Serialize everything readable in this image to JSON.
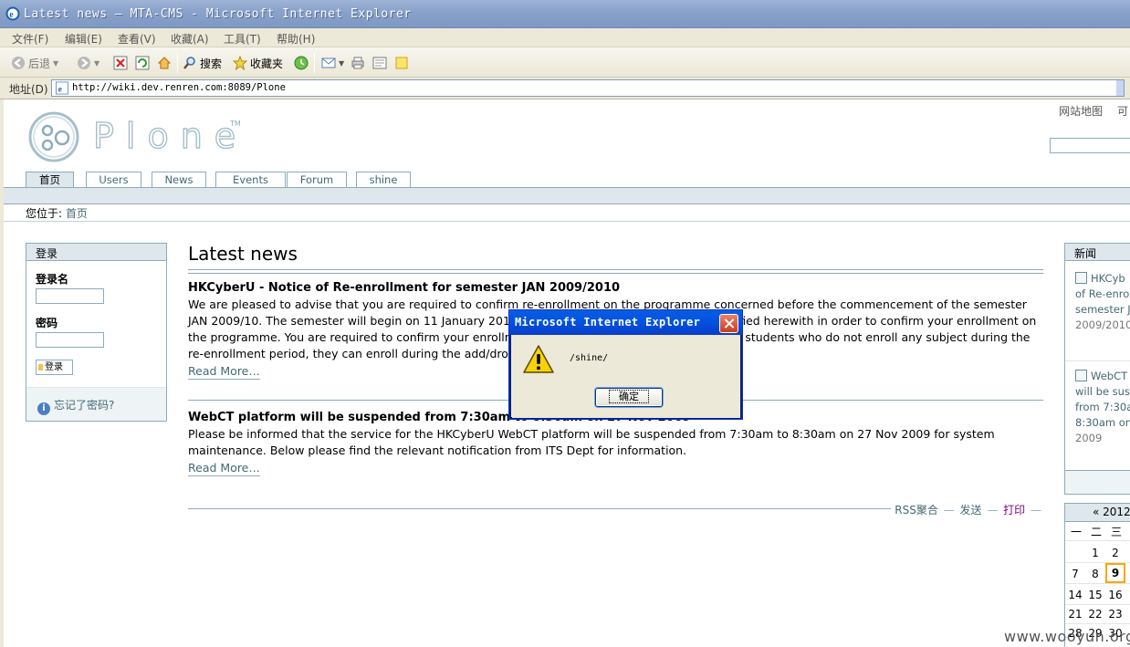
{
  "window": {
    "title": "Latest news — MTA-CMS - Microsoft Internet Explorer"
  },
  "menu": {
    "items": [
      "文件(F)",
      "编辑(E)",
      "查看(V)",
      "收藏(A)",
      "工具(T)",
      "帮助(H)"
    ]
  },
  "toolbar": {
    "back_label": "后退",
    "search_label": "搜索",
    "favorites_label": "收藏夹"
  },
  "address": {
    "label": "地址(D)",
    "url": "http://wiki.dev.renren.com:8089/Plone"
  },
  "site": {
    "logo_text": "Plone",
    "logo_tm": "TM",
    "site_actions": [
      "网站地图",
      "可"
    ]
  },
  "tabs": [
    "首页",
    "Users",
    "News",
    "Events",
    "Forum",
    "shine"
  ],
  "breadcrumb": {
    "prefix": "您位于:",
    "home": "首页"
  },
  "login": {
    "title": "登录",
    "username_label": "登录名",
    "password_label": "密码",
    "button_label": "登录",
    "forgot_label": "忘记了密码?"
  },
  "content": {
    "title": "Latest news",
    "items": [
      {
        "title": "HKCyberU - Notice of Re-enrollment for semester JAN 2009/2010",
        "body": "We are pleased to advise that you are required to confirm re-enrollment on the programme concerned before the commencement of the semester JAN 2009/10. The semester will begin on 11 January 2010. Please follow the procedures as specified herewith in order to confirm your enrollment on the programme. You are required to confirm your enrollment before the date specified. For those students who do not enroll any subject during the re-enrollment period, they can enroll during the add/drop period for the semester.",
        "read_more": "Read More…"
      },
      {
        "title": "WebCT platform will be suspended from 7:30am to 8:30am on 27 Nov 2009",
        "body": "Please be informed that the service for the HKCyberU WebCT platform will be suspended from 7:30am to 8:30am on 27 Nov 2009 for system maintenance. Below please find the relevant notification from ITS Dept for information.",
        "read_more": "Read More…"
      }
    ],
    "actions": [
      "RSS聚合",
      "发送",
      "打印"
    ]
  },
  "news_portlet": {
    "title": "新闻",
    "items": [
      {
        "lines": [
          "HKCyb",
          "of Re-enro",
          "semester J"
        ],
        "date": "2009/2010"
      },
      {
        "lines": [
          "WebCT",
          "will be sus",
          "from 7:30a",
          "8:30am on"
        ],
        "date": "2009"
      }
    ]
  },
  "calendar": {
    "header": "« 2012",
    "weekdays": [
      "一",
      "二",
      "三"
    ],
    "rows": [
      [
        "",
        "1",
        "2"
      ],
      [
        "7",
        "8",
        "9"
      ],
      [
        "14",
        "15",
        "16"
      ],
      [
        "21",
        "22",
        "23"
      ],
      [
        "28",
        "29",
        "30"
      ]
    ],
    "today": "9"
  },
  "dialog": {
    "title": "Microsoft Internet Explorer",
    "message": "/shine/",
    "ok_label": "确定"
  },
  "watermark": "www.wooyun.org",
  "colors": {
    "plone_border": "#8cacbb",
    "plone_bg": "#dee7ec",
    "link": "#436976",
    "today": "#ffa500"
  }
}
